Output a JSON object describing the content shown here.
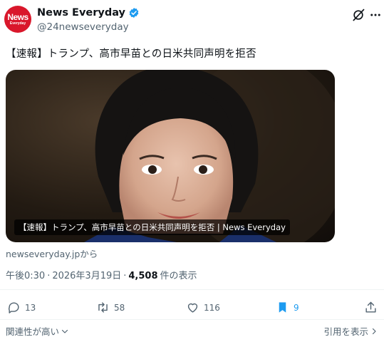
{
  "account": {
    "avatar_line1": "News",
    "avatar_line2": "Everyday",
    "display_name": "News Everyday",
    "handle": "@24newseveryday",
    "verified_icon": "verified-badge-icon"
  },
  "tweet": {
    "text": "【速報】トランプ、高市早苗との日米共同声明を拒否",
    "card_caption": "【速報】トランプ、高市早苗との日米共同声明を拒否 | News Everyday",
    "card_source": "newseveryday.jpから"
  },
  "meta": {
    "time": "午後0:30",
    "separator": "·",
    "date": "2026年3月19日",
    "views_count": "4,508",
    "views_label": "件の表示"
  },
  "actions": {
    "replies": "13",
    "reposts": "58",
    "likes": "116",
    "bookmarks": "9"
  },
  "footer": {
    "relevance_label": "関連性が高い",
    "quotes_label": "引用を表示"
  },
  "colors": {
    "accent": "#1d9bf0",
    "brand_red": "#d9172b",
    "muted_text": "#536471"
  }
}
